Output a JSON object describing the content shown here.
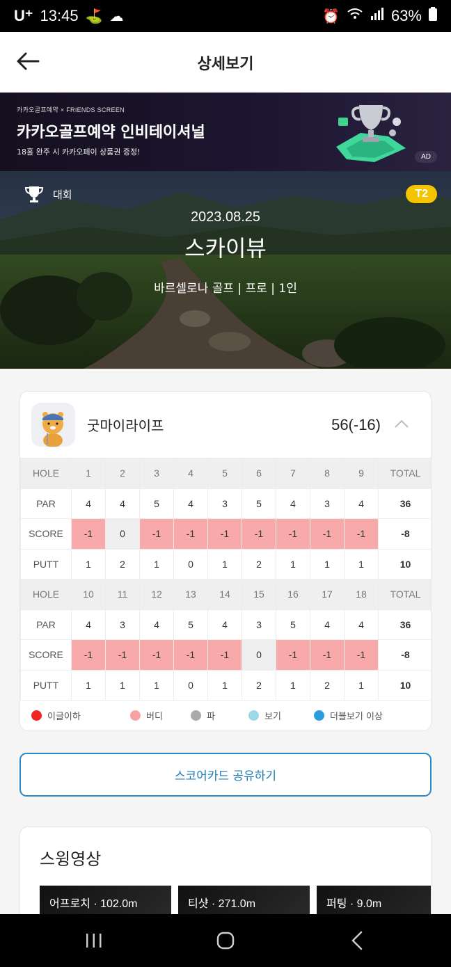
{
  "status": {
    "carrier": "U⁺",
    "time": "13:45",
    "battery": "63%"
  },
  "header": {
    "title": "상세보기"
  },
  "banner": {
    "brand": "카카오골프예약 × FRIENDS SCREEN",
    "title": "카카오골프예약 인비테이셔널",
    "subtitle": "18홀 완주 시 카카오페이 상품권 증정!",
    "ad_label": "AD"
  },
  "hero": {
    "tag": "대회",
    "badge": "T2",
    "date": "2023.08.25",
    "course": "스카이뷰",
    "info": "바르셀로나 골프 | 프로 | 1인"
  },
  "player": {
    "name": "굿마이라이프",
    "total": "56(-16)"
  },
  "scorecard": {
    "labels": {
      "hole": "HOLE",
      "par": "PAR",
      "score": "SCORE",
      "putt": "PUTT",
      "total": "TOTAL"
    },
    "front": {
      "holes": [
        "1",
        "2",
        "3",
        "4",
        "5",
        "6",
        "7",
        "8",
        "9"
      ],
      "par": [
        "4",
        "4",
        "5",
        "4",
        "3",
        "5",
        "4",
        "3",
        "4"
      ],
      "par_total": "36",
      "score": [
        "-1",
        "0",
        "-1",
        "-1",
        "-1",
        "-1",
        "-1",
        "-1",
        "-1"
      ],
      "score_total": "-8",
      "putt": [
        "1",
        "2",
        "1",
        "0",
        "1",
        "2",
        "1",
        "1",
        "1"
      ],
      "putt_total": "10"
    },
    "back": {
      "holes": [
        "10",
        "11",
        "12",
        "13",
        "14",
        "15",
        "16",
        "17",
        "18"
      ],
      "par": [
        "4",
        "3",
        "4",
        "5",
        "4",
        "3",
        "5",
        "4",
        "4"
      ],
      "par_total": "36",
      "score": [
        "-1",
        "-1",
        "-1",
        "-1",
        "-1",
        "0",
        "-1",
        "-1",
        "-1"
      ],
      "score_total": "-8",
      "putt": [
        "1",
        "1",
        "1",
        "0",
        "1",
        "2",
        "1",
        "2",
        "1"
      ],
      "putt_total": "10"
    }
  },
  "legend": [
    {
      "label": "이글이하",
      "color": "#f02424"
    },
    {
      "label": "버디",
      "color": "#f5a3a3"
    },
    {
      "label": "파",
      "color": "#aaaaaa"
    },
    {
      "label": "보기",
      "color": "#9ed9e8"
    },
    {
      "label": "더블보기 이상",
      "color": "#2a9de0"
    }
  ],
  "share_button": "스코어카드 공유하기",
  "swing": {
    "title": "스윙영상",
    "videos": [
      "어프로치 · 102.0m",
      "티샷 · 271.0m",
      "퍼팅 · 9.0m"
    ]
  }
}
